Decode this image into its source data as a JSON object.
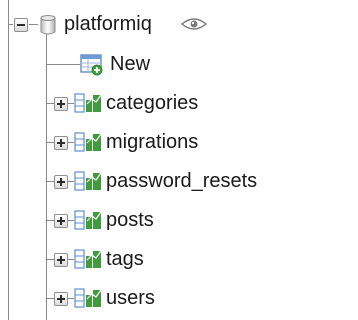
{
  "database": {
    "name": "platformiq",
    "db_icon": "database-cylinder-icon",
    "view_icon": "eye-icon",
    "expand_state": "expanded"
  },
  "new_item": {
    "label": "New",
    "icon": "new-table-icon"
  },
  "tables": [
    {
      "label": "categories",
      "icon": "table-structure-icon"
    },
    {
      "label": "migrations",
      "icon": "table-structure-icon"
    },
    {
      "label": "password_resets",
      "icon": "table-structure-icon"
    },
    {
      "label": "posts",
      "icon": "table-structure-icon"
    },
    {
      "label": "tags",
      "icon": "table-structure-icon"
    },
    {
      "label": "users",
      "icon": "table-structure-icon"
    }
  ],
  "colors": {
    "tree_line": "#8a8a8a",
    "text": "#1a1a1a",
    "table_icon_green": "#3f9b3c",
    "table_icon_blue": "#5c8fcf",
    "new_icon_plus": "#3aa43a"
  }
}
